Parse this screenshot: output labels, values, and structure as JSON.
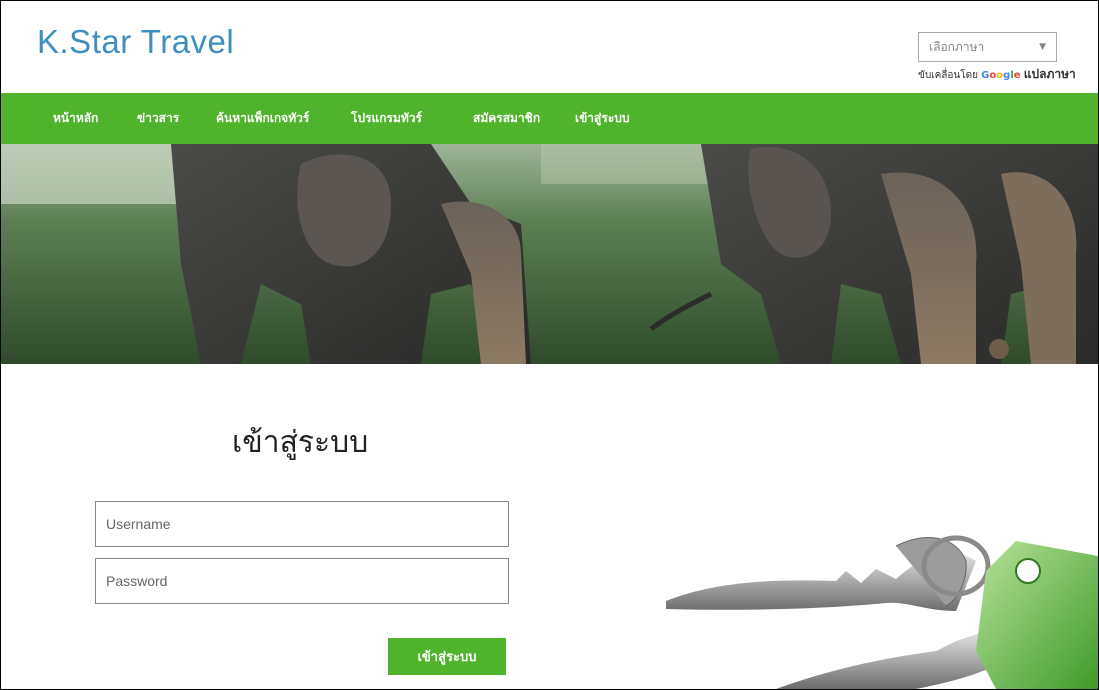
{
  "header": {
    "brand": "K.Star Travel",
    "language_select": {
      "selected": "เลือกภาษา",
      "arrow": "▼"
    },
    "powered_by": {
      "prefix": "ขับเคลื่อนโดย ",
      "google": [
        "G",
        "o",
        "o",
        "g",
        "l",
        "e"
      ],
      "translate": "แปลภาษา"
    }
  },
  "nav": {
    "items": [
      {
        "label": "หน้าหลัก"
      },
      {
        "label": "ข่าวสาร"
      },
      {
        "label": "ค้นหาแพ็กเกจทัวร์"
      },
      {
        "label": "โปรแกรมทัวร์"
      },
      {
        "label": "สมัครสมาชิก"
      },
      {
        "label": "เข้าสู่ระบบ"
      }
    ]
  },
  "login": {
    "title": "เข้าสู่ระบบ",
    "username_placeholder": "Username",
    "password_placeholder": "Password",
    "submit_label": "เข้าสู่ระบบ"
  },
  "colors": {
    "brand": "#3f8fbe",
    "nav_bg": "#4fb32b",
    "button_bg": "#4fb32b"
  }
}
